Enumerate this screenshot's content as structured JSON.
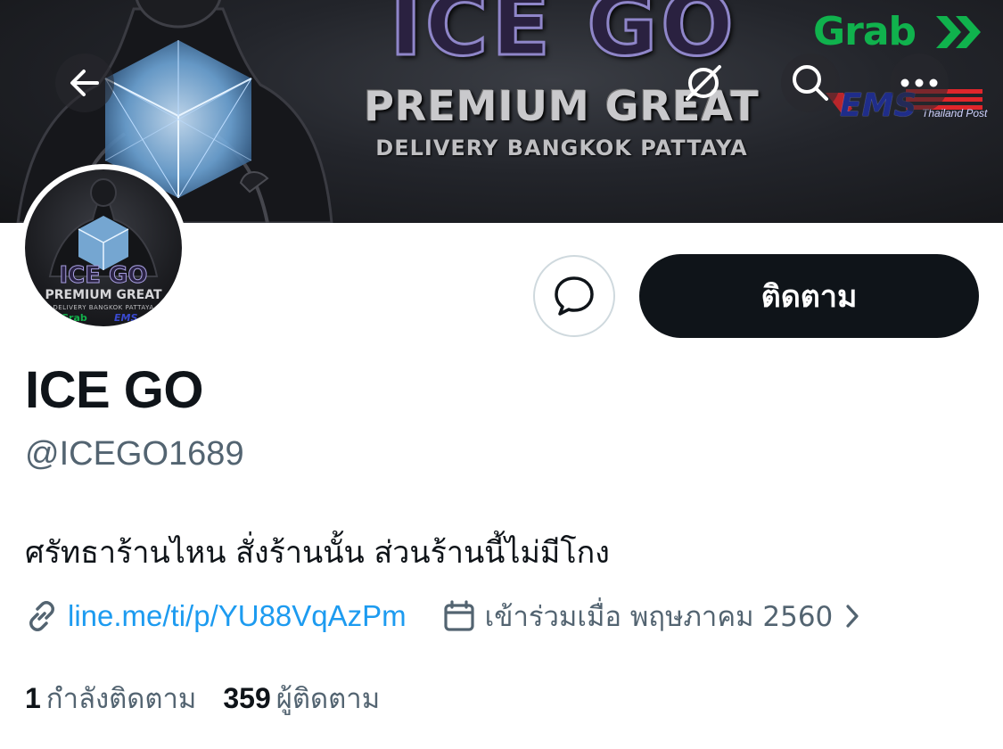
{
  "banner": {
    "title": "ICE GO",
    "subtitle": "PREMIUM GREAT",
    "tagline": "DELIVERY BANGKOK PATTAYA",
    "grab_logo": "Grab",
    "ems_logo": "EMS",
    "ems_sub": "Thailand Post",
    "icons": [
      "back-arrow-icon",
      "grok-icon",
      "search-icon",
      "more-icon"
    ]
  },
  "avatar": {
    "title": "ICE GO",
    "subtitle": "PREMIUM GREAT",
    "tagline": "DELIVERY BANGKOK PATTAYA",
    "grab": "Grab",
    "ems": "EMS"
  },
  "actions": {
    "message_icon": "message-bubble-icon",
    "follow_label": "ติดตาม"
  },
  "profile": {
    "display_name": "ICE GO",
    "handle": "@ICEGO1689",
    "bio": "ศรัทธาร้านไหน สั่งร้านนั้น ส่วนร้านนี้ไม่มีโกง",
    "link": "line.me/ti/p/YU88VqAzPm",
    "joined": "เข้าร่วมเมื่อ พฤษภาคม 2560"
  },
  "stats": {
    "following_count": "1",
    "following_label": "กำลังติดตาม",
    "followers_count": "359",
    "followers_label": "ผู้ติดตาม"
  },
  "colors": {
    "accent_link": "#1d9bf0",
    "text_primary": "#0f1419",
    "text_secondary": "#536471",
    "follow_bg": "#0f1419"
  }
}
